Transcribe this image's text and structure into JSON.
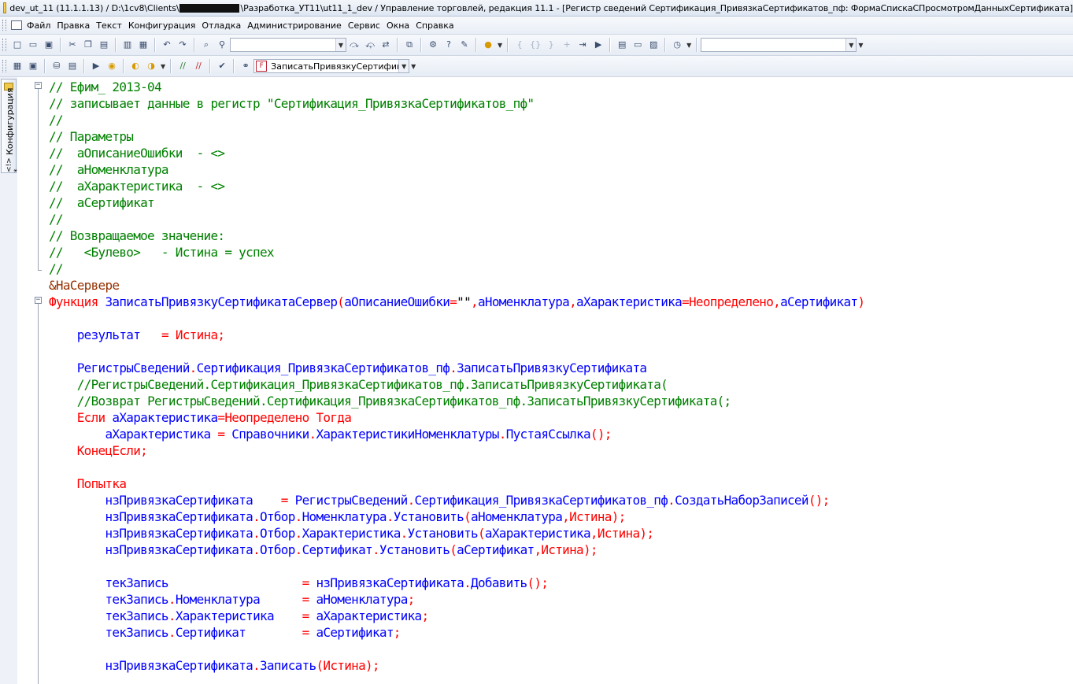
{
  "window": {
    "title_prefix": "dev_ut_11 (11.1.1.13) / D:\\1cv8\\Clients\\",
    "title_suffix": "\\Разработка_УТ11\\ut11_1_dev / Управление торговлей, редакция 11.1 - [Регистр сведений Сертификация_ПривязкаСертификатов_пф: ФормаСпискаСПросмотромДанныхСертификата]"
  },
  "menu": [
    "Файл",
    "Правка",
    "Текст",
    "Конфигурация",
    "Отладка",
    "Администрирование",
    "Сервис",
    "Окна",
    "Справка"
  ],
  "toolbar2": {
    "procedure_combo": "ЗаписатьПривязкуСертификата"
  },
  "sidebar": {
    "tab_label": "Конфигурация",
    "tab_marks": "<!> *"
  },
  "code": [
    [
      [
        "c",
        "// Ефим_ 2013-04"
      ]
    ],
    [
      [
        "c",
        "// записывает данные в регистр \"Сертификация_ПривязкаСертификатов_пф\""
      ]
    ],
    [
      [
        "c",
        "//"
      ]
    ],
    [
      [
        "c",
        "// Параметры"
      ]
    ],
    [
      [
        "c",
        "//  аОписаниеОшибки  - <>"
      ]
    ],
    [
      [
        "c",
        "//  аНоменклатура"
      ]
    ],
    [
      [
        "c",
        "//  аХарактеристика  - <>"
      ]
    ],
    [
      [
        "c",
        "//  аСертификат"
      ]
    ],
    [
      [
        "c",
        "//"
      ]
    ],
    [
      [
        "c",
        "// Возвращаемое значение:"
      ]
    ],
    [
      [
        "c",
        "//   <Булево>   - Истина = успех"
      ]
    ],
    [
      [
        "c",
        "//"
      ]
    ],
    [
      [
        "p",
        "&НаСервере"
      ]
    ],
    [
      [
        "k",
        "Функция "
      ],
      [
        "i",
        "ЗаписатьПривязкуСертификатаСервер"
      ],
      [
        "k",
        "("
      ],
      [
        "i",
        "аОписаниеОшибки"
      ],
      [
        "k",
        "="
      ],
      [
        "s",
        "\"\""
      ],
      [
        "k",
        ","
      ],
      [
        "i",
        "аНоменклатура"
      ],
      [
        "k",
        ","
      ],
      [
        "i",
        "аХарактеристика"
      ],
      [
        "k",
        "=Неопределено,"
      ],
      [
        "i",
        "аСертификат"
      ],
      [
        "k",
        ")"
      ]
    ],
    [],
    [
      [
        "s",
        "    "
      ],
      [
        "i",
        "результат"
      ],
      [
        "s",
        "   "
      ],
      [
        "k",
        "= Истина;"
      ]
    ],
    [],
    [
      [
        "s",
        "    "
      ],
      [
        "i",
        "РегистрыСведений"
      ],
      [
        "k",
        "."
      ],
      [
        "i",
        "Сертификация_ПривязкаСертификатов_пф"
      ],
      [
        "k",
        "."
      ],
      [
        "i",
        "ЗаписатьПривязкуСертификата"
      ]
    ],
    [
      [
        "s",
        "    "
      ],
      [
        "c",
        "//РегистрыСведений.Сертификация_ПривязкаСертификатов_пф.ЗаписатьПривязкуСертификата("
      ]
    ],
    [
      [
        "s",
        "    "
      ],
      [
        "c",
        "//Возврат РегистрыСведений.Сертификация_ПривязкаСертификатов_пф.ЗаписатьПривязкуСертификата(;"
      ]
    ],
    [
      [
        "s",
        "    "
      ],
      [
        "k",
        "Если "
      ],
      [
        "i",
        "аХарактеристика"
      ],
      [
        "k",
        "=Неопределено Тогда"
      ]
    ],
    [
      [
        "s",
        "        "
      ],
      [
        "i",
        "аХарактеристика"
      ],
      [
        "s",
        " "
      ],
      [
        "k",
        "="
      ],
      [
        "s",
        " "
      ],
      [
        "i",
        "Справочники"
      ],
      [
        "k",
        "."
      ],
      [
        "i",
        "ХарактеристикиНоменклатуры"
      ],
      [
        "k",
        "."
      ],
      [
        "i",
        "ПустаяСсылка"
      ],
      [
        "k",
        "();"
      ]
    ],
    [
      [
        "s",
        "    "
      ],
      [
        "k",
        "КонецЕсли;"
      ]
    ],
    [],
    [
      [
        "s",
        "    "
      ],
      [
        "k",
        "Попытка"
      ]
    ],
    [
      [
        "s",
        "        "
      ],
      [
        "i",
        "нзПривязкаСертификата"
      ],
      [
        "s",
        "    "
      ],
      [
        "k",
        "="
      ],
      [
        "s",
        " "
      ],
      [
        "i",
        "РегистрыСведений"
      ],
      [
        "k",
        "."
      ],
      [
        "i",
        "Сертификация_ПривязкаСертификатов_пф"
      ],
      [
        "k",
        "."
      ],
      [
        "i",
        "СоздатьНаборЗаписей"
      ],
      [
        "k",
        "();"
      ]
    ],
    [
      [
        "s",
        "        "
      ],
      [
        "i",
        "нзПривязкаСертификата"
      ],
      [
        "k",
        "."
      ],
      [
        "i",
        "Отбор"
      ],
      [
        "k",
        "."
      ],
      [
        "i",
        "Номенклатура"
      ],
      [
        "k",
        "."
      ],
      [
        "i",
        "Установить"
      ],
      [
        "k",
        "("
      ],
      [
        "i",
        "аНоменклатура"
      ],
      [
        "k",
        ",Истина);"
      ]
    ],
    [
      [
        "s",
        "        "
      ],
      [
        "i",
        "нзПривязкаСертификата"
      ],
      [
        "k",
        "."
      ],
      [
        "i",
        "Отбор"
      ],
      [
        "k",
        "."
      ],
      [
        "i",
        "Характеристика"
      ],
      [
        "k",
        "."
      ],
      [
        "i",
        "Установить"
      ],
      [
        "k",
        "("
      ],
      [
        "i",
        "аХарактеристика"
      ],
      [
        "k",
        ",Истина);"
      ]
    ],
    [
      [
        "s",
        "        "
      ],
      [
        "i",
        "нзПривязкаСертификата"
      ],
      [
        "k",
        "."
      ],
      [
        "i",
        "Отбор"
      ],
      [
        "k",
        "."
      ],
      [
        "i",
        "Сертификат"
      ],
      [
        "k",
        "."
      ],
      [
        "i",
        "Установить"
      ],
      [
        "k",
        "("
      ],
      [
        "i",
        "аСертификат"
      ],
      [
        "k",
        ",Истина);"
      ]
    ],
    [],
    [
      [
        "s",
        "        "
      ],
      [
        "i",
        "текЗапись"
      ],
      [
        "s",
        "                   "
      ],
      [
        "k",
        "="
      ],
      [
        "s",
        " "
      ],
      [
        "i",
        "нзПривязкаСертификата"
      ],
      [
        "k",
        "."
      ],
      [
        "i",
        "Добавить"
      ],
      [
        "k",
        "();"
      ]
    ],
    [
      [
        "s",
        "        "
      ],
      [
        "i",
        "текЗапись"
      ],
      [
        "k",
        "."
      ],
      [
        "i",
        "Номенклатура"
      ],
      [
        "s",
        "      "
      ],
      [
        "k",
        "="
      ],
      [
        "s",
        " "
      ],
      [
        "i",
        "аНоменклатура"
      ],
      [
        "k",
        ";"
      ]
    ],
    [
      [
        "s",
        "        "
      ],
      [
        "i",
        "текЗапись"
      ],
      [
        "k",
        "."
      ],
      [
        "i",
        "Характеристика"
      ],
      [
        "s",
        "    "
      ],
      [
        "k",
        "="
      ],
      [
        "s",
        " "
      ],
      [
        "i",
        "аХарактеристика"
      ],
      [
        "k",
        ";"
      ]
    ],
    [
      [
        "s",
        "        "
      ],
      [
        "i",
        "текЗапись"
      ],
      [
        "k",
        "."
      ],
      [
        "i",
        "Сертификат"
      ],
      [
        "s",
        "        "
      ],
      [
        "k",
        "="
      ],
      [
        "s",
        " "
      ],
      [
        "i",
        "аСертификат"
      ],
      [
        "k",
        ";"
      ]
    ],
    [],
    [
      [
        "s",
        "        "
      ],
      [
        "i",
        "нзПривязкаСертификата"
      ],
      [
        "k",
        "."
      ],
      [
        "i",
        "Записать"
      ],
      [
        "k",
        "(Истина);"
      ]
    ]
  ]
}
